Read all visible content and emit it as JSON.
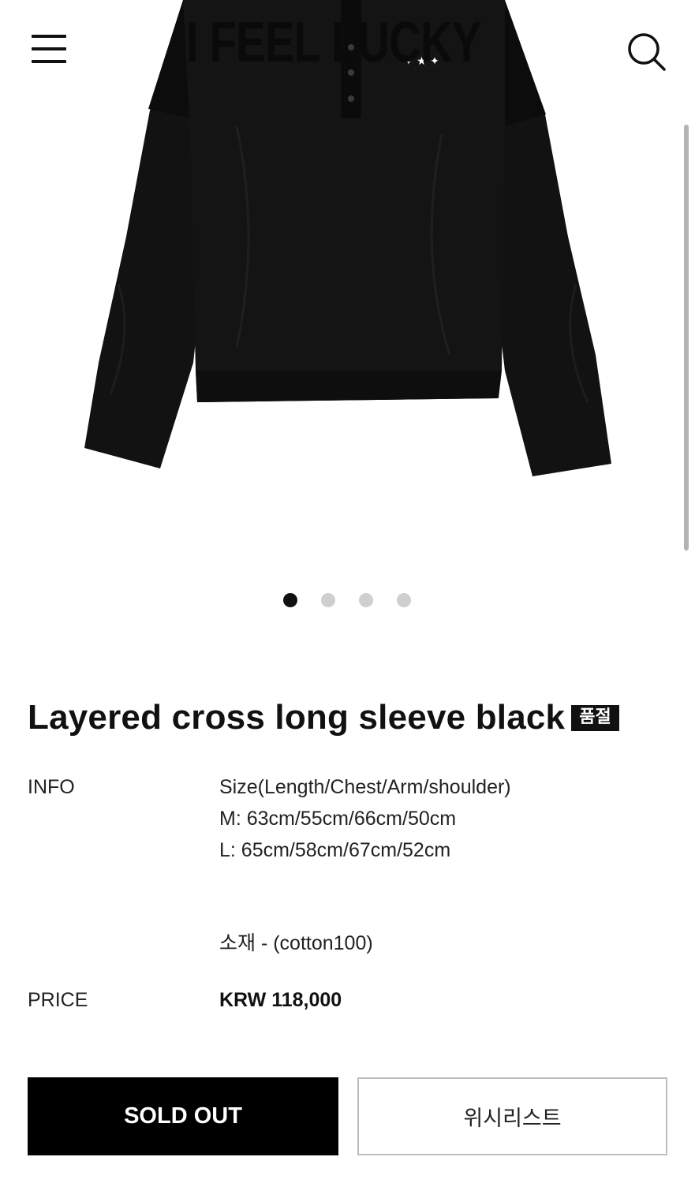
{
  "header": {
    "brand": "I FEEL LUCKY",
    "menu_icon": "hamburger-menu-icon",
    "search_icon": "search-icon"
  },
  "gallery": {
    "image_subject": "black layered long sleeve henley shirt",
    "slide_count": 4,
    "active_slide": 1
  },
  "product": {
    "title": "Layered cross long sleeve black",
    "badge": "품절",
    "info_label": "INFO",
    "info_lines": [
      "Size(Length/Chest/Arm/shoulder)",
      "M: 63cm/55cm/66cm/50cm",
      "L: 65cm/58cm/67cm/52cm"
    ],
    "material": "소재 - (cotton100)",
    "price_label": "PRICE",
    "price": "KRW 118,000"
  },
  "actions": {
    "sold_out_label": "SOLD OUT",
    "wishlist_label": "위시리스트"
  },
  "colors": {
    "primary": "#000000",
    "badge_bg": "#111111",
    "dot_inactive": "#cfcfcf",
    "border": "#bdbdbd"
  }
}
